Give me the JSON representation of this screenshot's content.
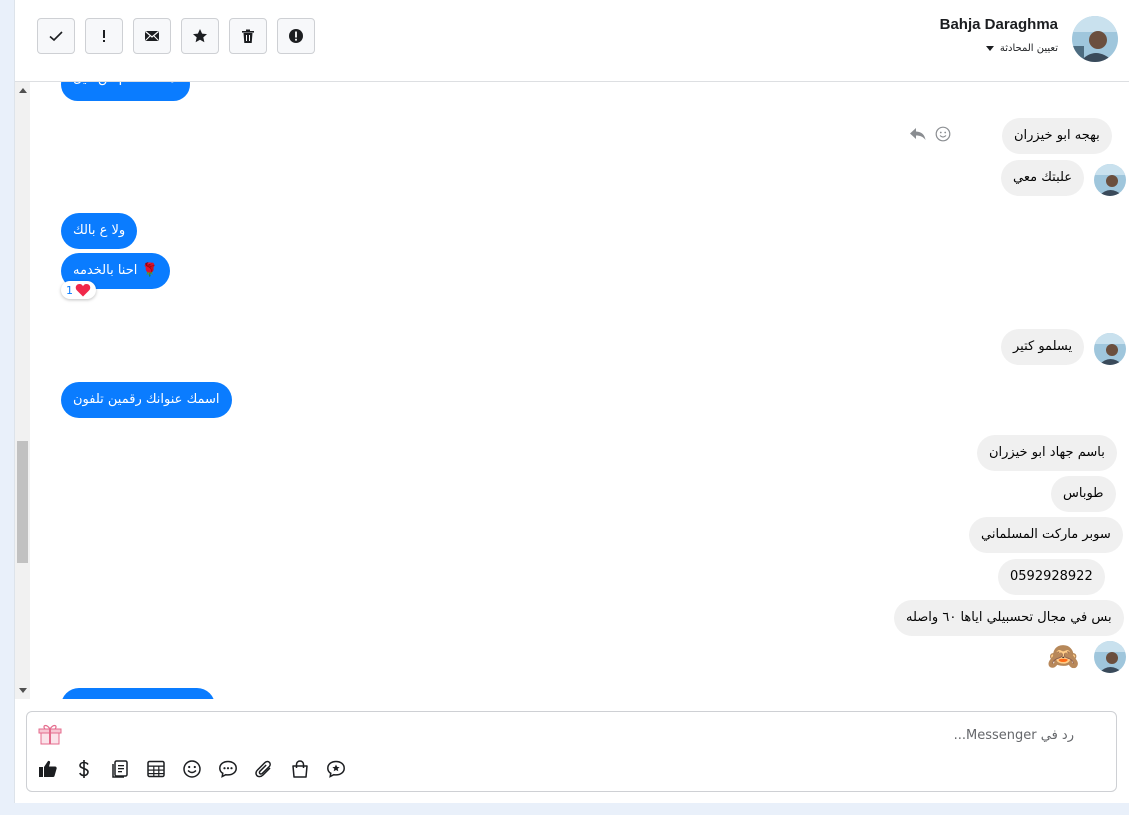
{
  "header": {
    "name": "Bahja Daraghma",
    "assign_label": "تعيين المحادثة",
    "tools": [
      {
        "name": "mark-done-button",
        "icon": "check-icon"
      },
      {
        "name": "mark-important-button",
        "icon": "exclamation-icon"
      },
      {
        "name": "mark-unread-button",
        "icon": "envelope-icon"
      },
      {
        "name": "star-button",
        "icon": "star-icon"
      },
      {
        "name": "delete-button",
        "icon": "trash-icon"
      },
      {
        "name": "spam-button",
        "icon": "alert-circle-icon"
      }
    ]
  },
  "messages": {
    "top_cut": "اهداء مقدم من ميل",
    "in_1": "بهجه ابو خيزران",
    "in_2": "علبتك معي",
    "out_1": "ولا ع بالك",
    "out_2": "احنا بالخدمه 🌹",
    "reaction_count": "1",
    "in_3": "يسلمو كتير",
    "out_3": "اسمك عنوانك رقمين تلفون",
    "in_4": "باسم جهاد ابو خيزران",
    "in_5": "طوباس",
    "in_6": "سوبر ماركت المسلماني",
    "in_7": "0592928922",
    "in_8": "بس في مجال تحسبيلي اياها ٦٠ واصله",
    "in_9": "🙈"
  },
  "composer": {
    "placeholder": "رد في Messenger...",
    "tools": [
      "like-icon",
      "dollar-icon",
      "catalog-icon",
      "table-icon",
      "emoji-icon",
      "saved-replies-icon",
      "attachment-icon",
      "shop-bag-icon",
      "appointment-icon"
    ]
  },
  "colors": {
    "outgoing_bubble": "#0a7cff",
    "incoming_bubble": "#f0f0f0"
  }
}
